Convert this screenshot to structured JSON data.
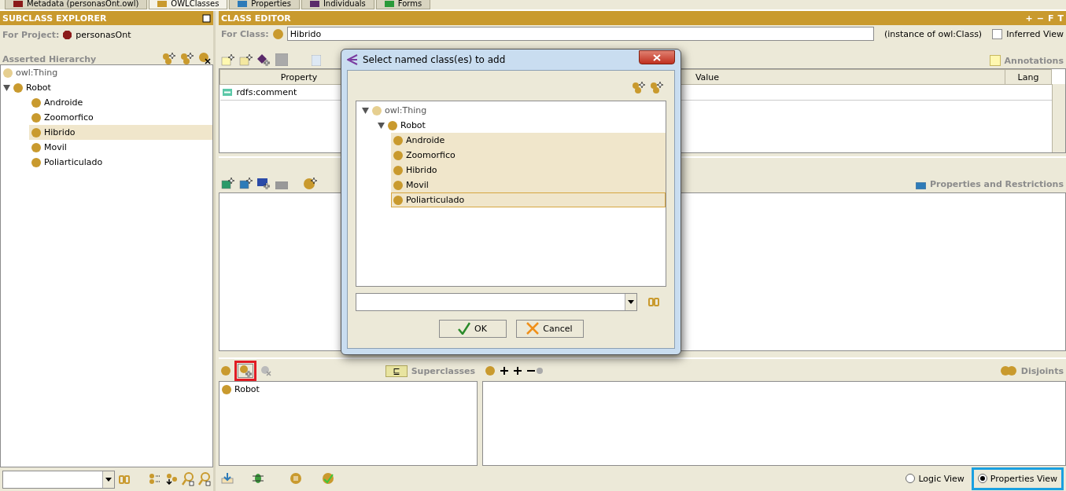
{
  "tabs": [
    {
      "label": "Metadata (personasOnt.owl)",
      "kind": "metadata",
      "selected": false
    },
    {
      "label": "OWLClasses",
      "kind": "classes",
      "selected": true
    },
    {
      "label": "Properties",
      "kind": "properties",
      "selected": false
    },
    {
      "label": "Individuals",
      "kind": "individuals",
      "selected": false
    },
    {
      "label": "Forms",
      "kind": "forms",
      "selected": false
    }
  ],
  "subclass_explorer": {
    "title": "SUBCLASS EXPLORER",
    "project_label": "For Project:",
    "project": "personasOnt",
    "hierarchy_label": "Asserted Hierarchy",
    "tree": [
      {
        "label": "owl:Thing",
        "kind": "root",
        "selected": false
      },
      {
        "label": "Robot",
        "kind": "class",
        "selected": false,
        "expanded": true,
        "children": [
          {
            "label": "Androide",
            "kind": "class",
            "selected": false
          },
          {
            "label": "Zoomorfico",
            "kind": "class",
            "selected": false
          },
          {
            "label": "Hibrido",
            "kind": "class",
            "selected": true
          },
          {
            "label": "Movil",
            "kind": "class",
            "selected": false
          },
          {
            "label": "Poliarticulado",
            "kind": "class",
            "selected": false
          }
        ]
      }
    ]
  },
  "class_editor": {
    "title": "CLASS EDITOR",
    "header_buttons": [
      "+",
      "−",
      "F",
      "T"
    ],
    "for_class_label": "For Class:",
    "class_name": "Hibrido",
    "instance_of": "(instance of owl:Class)",
    "inferred_view": {
      "label": "Inferred View",
      "checked": false
    },
    "annotations_label": "Annotations",
    "columns": [
      "Property",
      "Value",
      "Lang"
    ],
    "rows": [
      {
        "property": "rdfs:comment"
      }
    ],
    "properties_label": "Properties and Restrictions",
    "superclasses": {
      "symbol": "⊑",
      "label": "Superclasses",
      "items": [
        "Robot"
      ]
    },
    "disjoints_label": "Disjoints",
    "views": [
      {
        "label": "Logic View",
        "selected": false
      },
      {
        "label": "Properties View",
        "selected": true
      }
    ]
  },
  "dialog": {
    "title": "Select named class(es) to add",
    "tree": [
      {
        "label": "owl:Thing",
        "kind": "root",
        "selected": false,
        "expanded": true,
        "children": [
          {
            "label": "Robot",
            "kind": "class",
            "selected": false,
            "expanded": true,
            "children": [
              {
                "label": "Androide",
                "kind": "class",
                "selected": true
              },
              {
                "label": "Zoomorfico",
                "kind": "class",
                "selected": true
              },
              {
                "label": "Hibrido",
                "kind": "class",
                "selected": true
              },
              {
                "label": "Movil",
                "kind": "class",
                "selected": true
              },
              {
                "label": "Poliarticulado",
                "kind": "class",
                "selected": true,
                "focused": true
              }
            ]
          }
        ]
      }
    ],
    "buttons": [
      {
        "label": "OK",
        "kind": "ok"
      },
      {
        "label": "Cancel",
        "kind": "cancel"
      }
    ]
  }
}
